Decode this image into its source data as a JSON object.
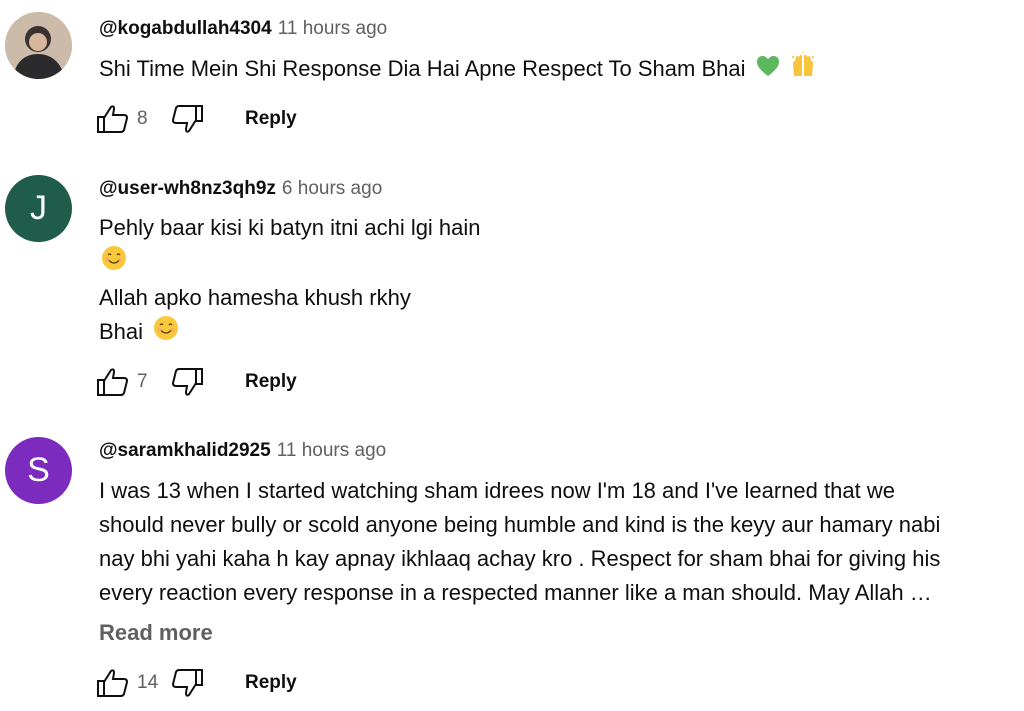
{
  "comments": [
    {
      "author": "@kogabdullah4304",
      "time": "11 hours ago",
      "avatar_letter": "",
      "lines": [
        "Shi Time Mein Shi Response Dia Hai Apne Respect To Sham Bhai"
      ],
      "emojis": [
        "green-heart-icon",
        "raised-hands-icon"
      ],
      "likes": "8",
      "reply_label": "Reply"
    },
    {
      "author": "@user-wh8nz3qh9z",
      "time": "6 hours ago",
      "avatar_letter": "J",
      "avatar_color": "#1f5c4a",
      "lines": [
        "Pehly baar kisi ki batyn itni achi lgi hain",
        "",
        "Allah apko hamesha khush rkhy",
        "Bhai"
      ],
      "emojis": [
        "smiling-face-icon"
      ],
      "likes": "7",
      "reply_label": "Reply"
    },
    {
      "author": "@saramkhalid2925",
      "time": "11 hours ago",
      "avatar_letter": "S",
      "avatar_color": "#7b2bbd",
      "lines": [
        "I was 13 when I started watching sham idrees now I'm  18 and I've  learned that we",
        "should never bully or scold anyone being humble and kind is the  keyy aur hamary nabi",
        "nay bhi yahi kaha h kay apnay ikhlaaq achay kro . Respect for sham bhai for giving  his",
        "every reaction every response  in a respected manner like a man should. May Allah …"
      ],
      "read_more": "Read more",
      "likes": "14",
      "reply_label": "Reply"
    }
  ]
}
